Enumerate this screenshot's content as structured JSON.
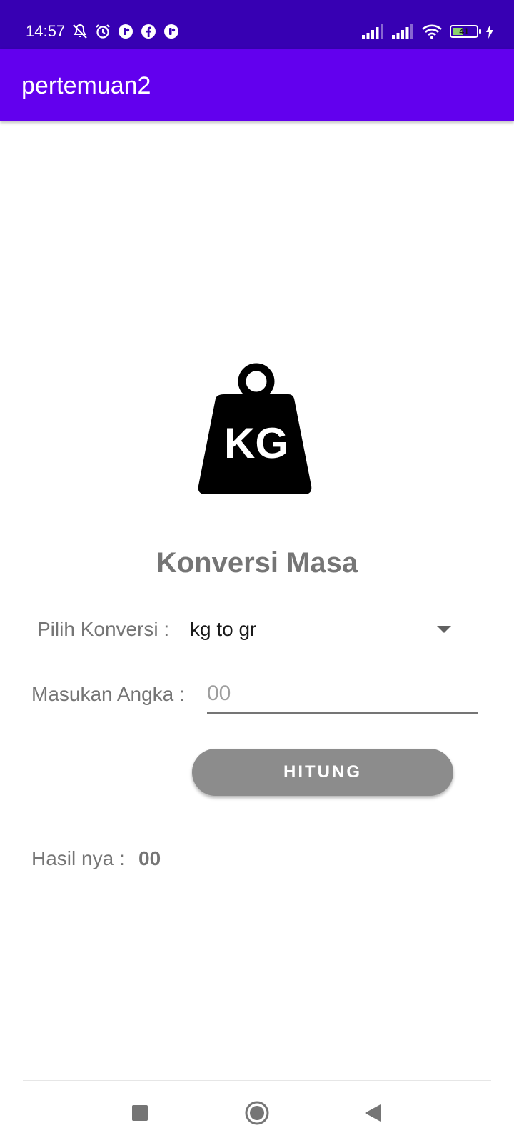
{
  "status_bar": {
    "time": "14:57",
    "battery_level": "41",
    "icons": [
      "mute-icon",
      "alarm-icon",
      "app-notification-icon",
      "facebook-icon",
      "app-notification-icon",
      "signal-icon",
      "signal-icon",
      "wifi-icon",
      "battery-icon",
      "charging-icon"
    ]
  },
  "app_bar": {
    "title": "pertemuan2"
  },
  "hero": {
    "icon": "kg-weight-icon",
    "icon_text": "KG"
  },
  "heading": "Konversi Masa",
  "form": {
    "pilih_label": "Pilih Konversi :",
    "spinner_value": "kg to gr",
    "masukan_label": "Masukan Angka :",
    "input_placeholder": "00",
    "input_value": "",
    "button_label": "HITUNG",
    "hasil_label": "Hasil nya :",
    "hasil_value": "00"
  },
  "nav_bar": {
    "icons": [
      "recents-icon",
      "home-icon",
      "back-icon"
    ]
  },
  "colors": {
    "status_bar": "#3700B3",
    "app_bar": "#6200EE",
    "button": "#8C8C8C",
    "label_text": "#757575",
    "battery_fill": "#8BD36B"
  }
}
